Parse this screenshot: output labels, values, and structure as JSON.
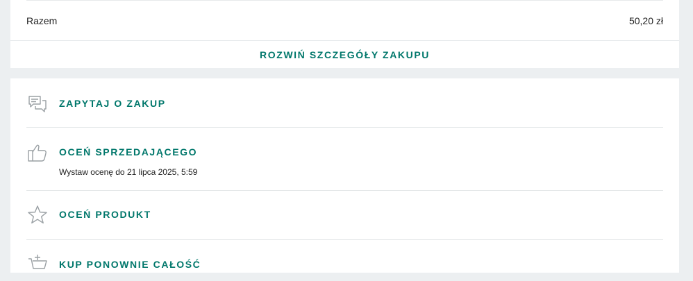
{
  "summary": {
    "total_label": "Razem",
    "total_value": "50,20 zł",
    "expand_label": "ROZWIŃ SZCZEGÓŁY ZAKUPU"
  },
  "actions": [
    {
      "label": "ZAPYTAJ O ZAKUP",
      "icon": "chat-bubbles-icon"
    },
    {
      "label": "OCEŃ SPRZEDAJĄCEGO",
      "sub": "Wystaw ocenę do 21 lipca 2025, 5:59",
      "icon": "thumbs-up-icon"
    },
    {
      "label": "OCEŃ PRODUKT",
      "icon": "star-icon"
    },
    {
      "label": "KUP PONOWNIE CAŁOŚĆ",
      "icon": "cart-icon"
    }
  ],
  "colors": {
    "accent": "#00776b",
    "background": "#eceff1",
    "card": "#ffffff",
    "icon": "#9aa0a4"
  }
}
